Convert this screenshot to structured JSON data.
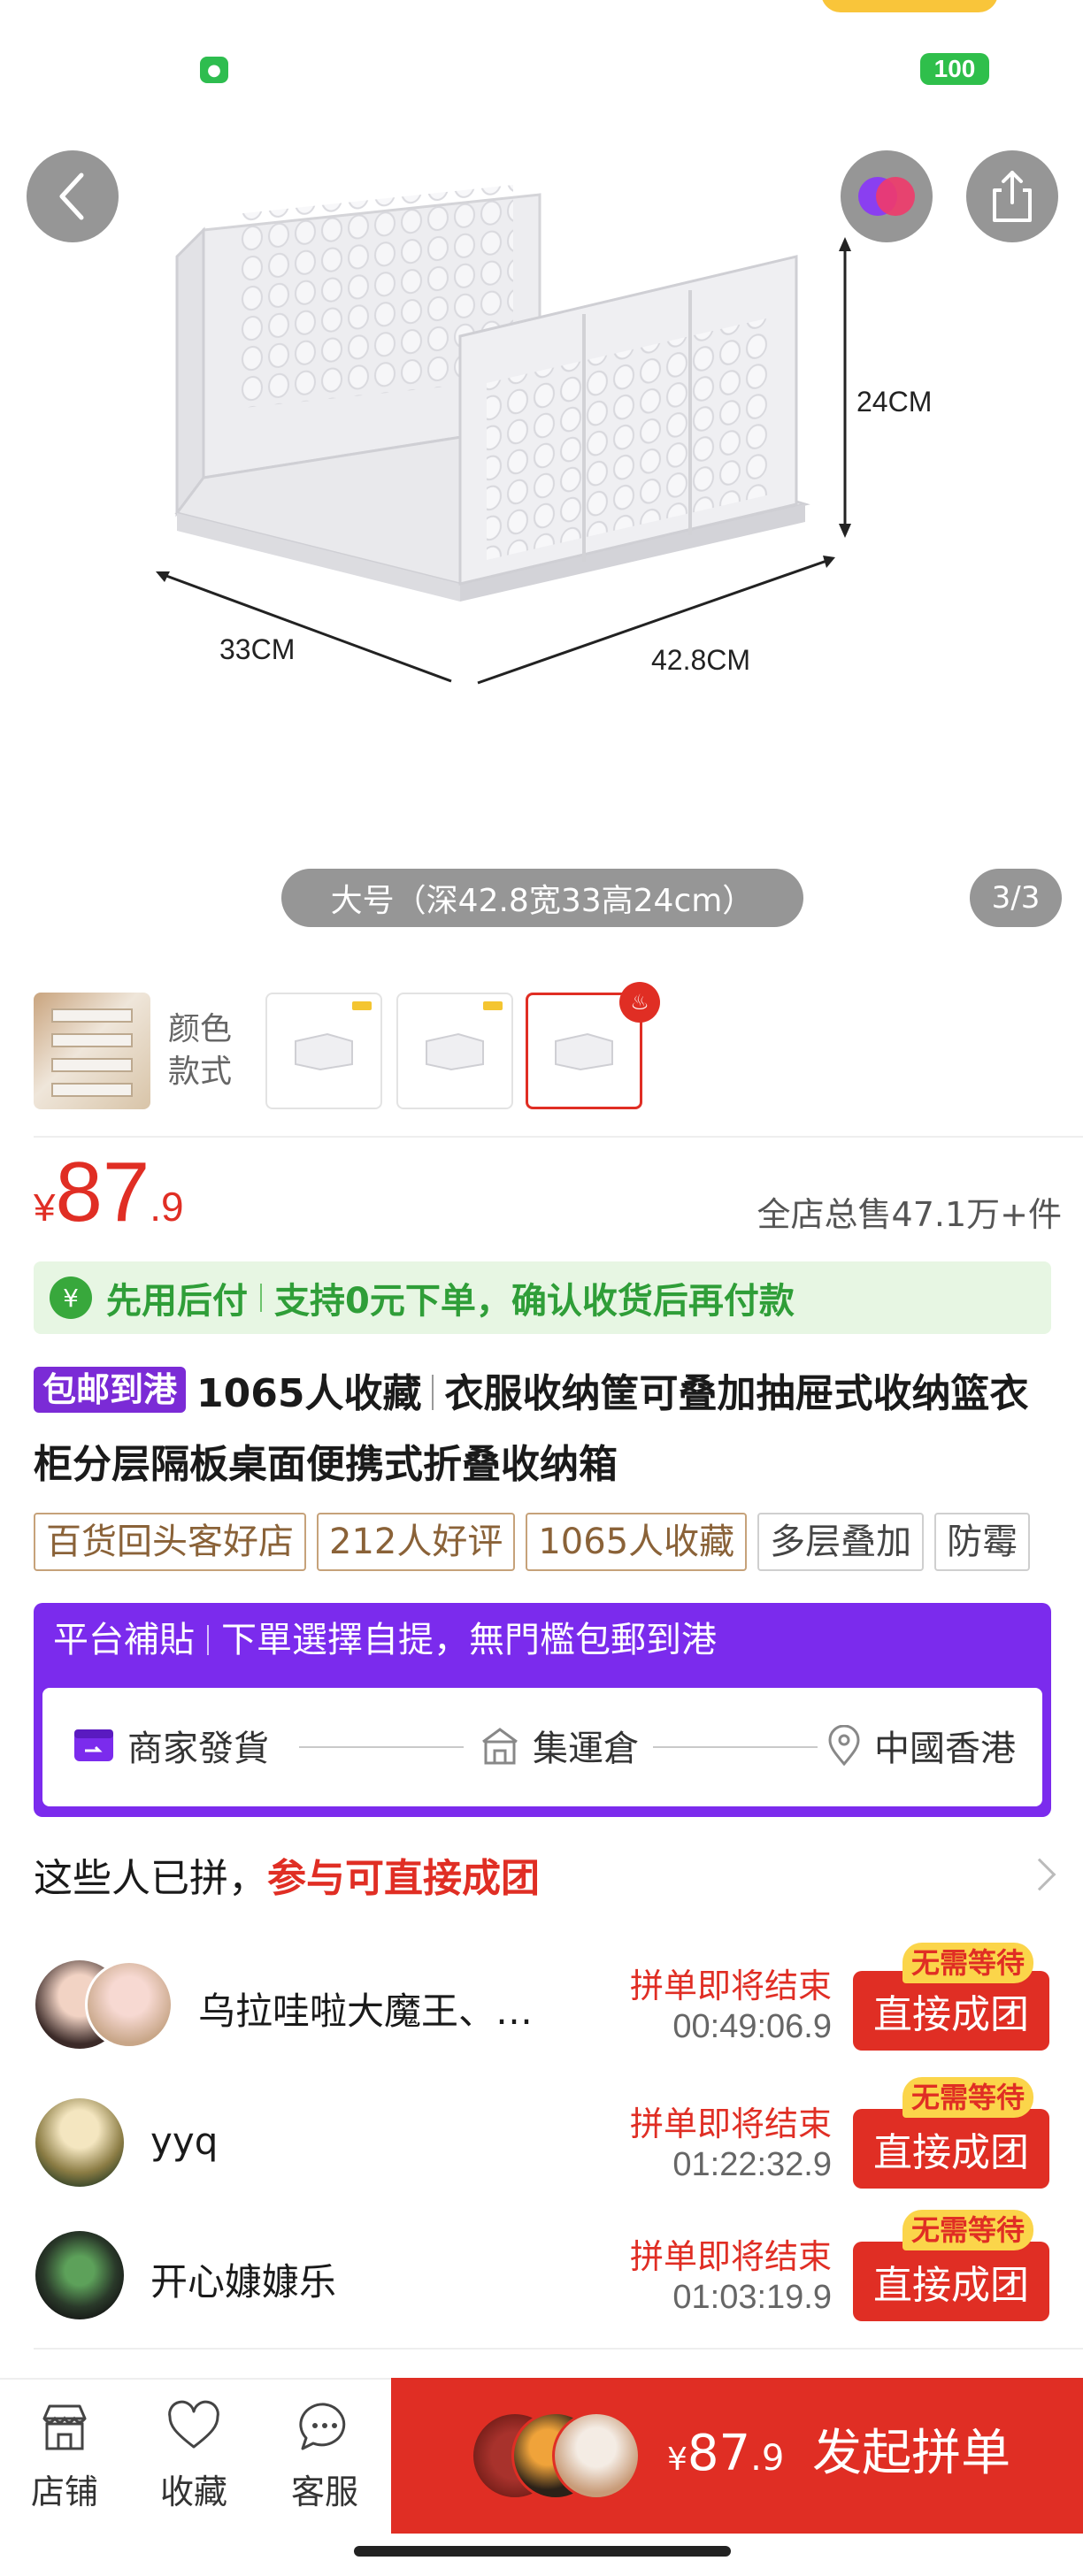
{
  "status": {
    "battery": "100"
  },
  "product_image": {
    "dimensions": {
      "height": "24CM",
      "depth": "33CM",
      "width": "42.8CM"
    },
    "variant_caption": "大号（深42.8宽33高24cm）",
    "page_indicator": "3/3"
  },
  "options": {
    "label": "颜色\n款式"
  },
  "price": {
    "currency": "¥",
    "integer": "87",
    "decimal": ".9"
  },
  "sales": "全店总售47.1万+件",
  "pay_later": {
    "title": "先用后付",
    "desc": "支持0元下单，确认收货后再付款"
  },
  "title": {
    "tag": "包邮到港",
    "favorites": "1065人收藏",
    "name": "衣服收纳筐可叠加抽屉式收纳篮衣柜分层隔板桌面便携式折叠收纳箱"
  },
  "tags": [
    {
      "label": "百货回头客好店",
      "style": "brown"
    },
    {
      "label": "212人好评",
      "style": "brown"
    },
    {
      "label": "1065人收藏",
      "style": "brown"
    },
    {
      "label": "多层叠加",
      "style": "gray"
    },
    {
      "label": "防霉",
      "style": "gray"
    }
  ],
  "subsidy": {
    "title": "平台補貼",
    "desc": "下單選擇自提，無門檻包郵到港",
    "route": [
      "商家發貨",
      "集運倉",
      "中國香港"
    ]
  },
  "group_buy": {
    "header_text": "这些人已拼，",
    "header_highlight": "参与可直接成团",
    "ending_label": "拼单即将结束",
    "join_label": "直接成团",
    "no_wait_label": "无需等待",
    "groups": [
      {
        "name": "乌拉哇啦大魔王、…",
        "timer": "00:49:06.9"
      },
      {
        "name": "yyq",
        "timer": "01:22:32.9"
      },
      {
        "name": "开心嫝嫝乐",
        "timer": "01:03:19.9"
      }
    ]
  },
  "bottom_bar": {
    "store": "店铺",
    "favorite": "收藏",
    "service": "客服",
    "cta_currency": "¥",
    "cta_price_int": "87",
    "cta_price_dec": ".9",
    "cta_label": "发起拼单"
  },
  "colors": {
    "accent_red": "#e02e24",
    "subsidy_purple": "#7b2bed",
    "paylater_green": "#2f9e38"
  }
}
